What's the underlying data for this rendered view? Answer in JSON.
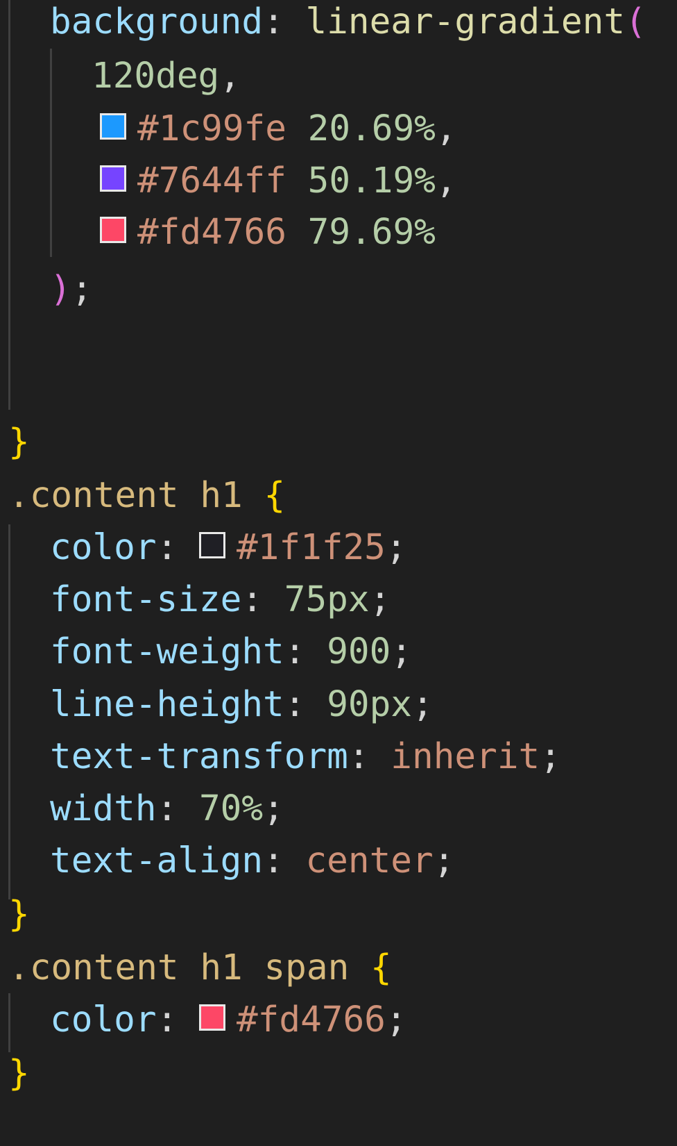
{
  "colors": {
    "background": "#1f1f1f",
    "property": "#9cdcfe",
    "punctuation": "#d4d4d4",
    "number": "#b5cea8",
    "string": "#ce9178",
    "function": "#dcdcaa",
    "paren": "#da70d6",
    "brace": "#ffd700",
    "selector": "#d7ba7d"
  },
  "code": {
    "bg_prop": "background",
    "colon_space": ": ",
    "bg_func": "linear-gradient",
    "open_paren": "(",
    "angle": "120deg",
    "comma": ",",
    "stop1": {
      "hex": "#1c99fe",
      "pct": "20.69%",
      "swatch": "#1c99fe"
    },
    "stop2": {
      "hex": "#7644ff",
      "pct": "50.19%",
      "swatch": "#7644ff"
    },
    "stop3": {
      "hex": "#fd4766",
      "pct": "79.69%",
      "swatch": "#fd4766"
    },
    "close_paren": ")",
    "semicolon": ";",
    "close_brace": "}",
    "h1_selector": ".content h1",
    "open_brace": "{",
    "h1_props": {
      "color_prop": "color",
      "color_val": "#1f1f25",
      "color_swatch": "#1f1f25",
      "font_size_prop": "font-size",
      "font_size_val": "75px",
      "font_weight_prop": "font-weight",
      "font_weight_val": "900",
      "line_height_prop": "line-height",
      "line_height_val": "90px",
      "text_transform_prop": "text-transform",
      "text_transform_val": "inherit",
      "width_prop": "width",
      "width_val": "70%",
      "text_align_prop": "text-align",
      "text_align_val": "center"
    },
    "span_selector": ".content h1 span",
    "span_color_prop": "color",
    "span_color_val": "#fd4766",
    "span_color_swatch": "#fd4766"
  }
}
